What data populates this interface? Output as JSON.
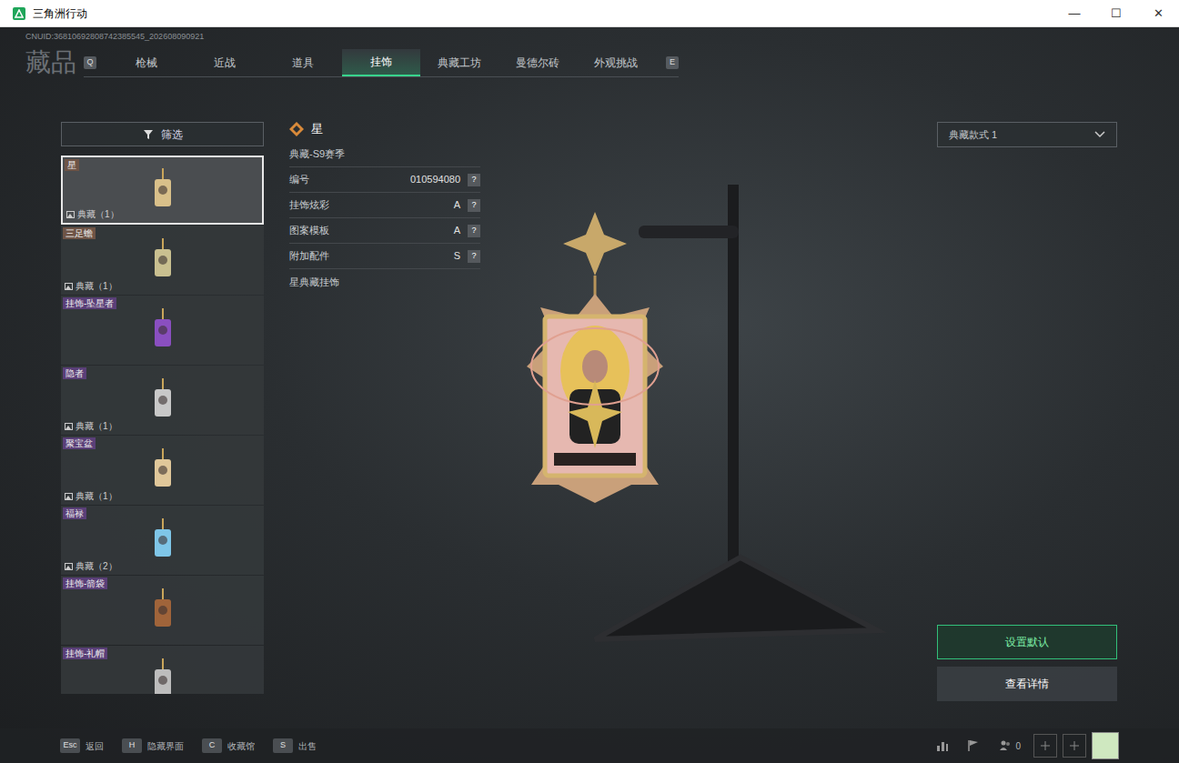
{
  "window": {
    "title": "三角洲行动",
    "controls": [
      "—",
      "☐",
      "✕"
    ]
  },
  "uid": "CNUID:36810692808742385545_202608090921",
  "page_title": "藏品",
  "tabs": {
    "prev_key": "Q",
    "next_key": "E",
    "items": [
      {
        "label": "枪械",
        "selected": false
      },
      {
        "label": "近战",
        "selected": false
      },
      {
        "label": "道具",
        "selected": false
      },
      {
        "label": "挂饰",
        "selected": true
      },
      {
        "label": "典藏工坊",
        "selected": false
      },
      {
        "label": "曼德尔砖",
        "selected": false
      },
      {
        "label": "外观挑战",
        "selected": false
      }
    ]
  },
  "filter": {
    "label": "筛选"
  },
  "items": [
    {
      "name": "星",
      "count": "典藏（1）",
      "selected": true,
      "color": "#6e5446"
    },
    {
      "name": "三足蟾",
      "count": "典藏（1）",
      "selected": false,
      "color": "#6e5446"
    },
    {
      "name": "挂饰-坠星者",
      "selected": false,
      "color": "#5a3f78"
    },
    {
      "name": "隐者",
      "count": "典藏（1）",
      "selected": false,
      "color": "#5a3f78"
    },
    {
      "name": "聚宝盆",
      "count": "典藏（1）",
      "selected": false,
      "color": "#5a3f78"
    },
    {
      "name": "福禄",
      "count": "典藏（2）",
      "selected": false,
      "color": "#5a3f78"
    },
    {
      "name": "挂饰-箭袋",
      "selected": false,
      "color": "#5a3f78"
    },
    {
      "name": "挂饰-礼帽",
      "selected": false,
      "color": "#5a3f78"
    }
  ],
  "detail": {
    "title": "星",
    "subtitle": "典藏-S9赛季",
    "attributes": [
      {
        "label": "编号",
        "value": "010594080",
        "help": "?"
      },
      {
        "label": "挂饰炫彩",
        "value": "A",
        "help": "?"
      },
      {
        "label": "图案模板",
        "value": "A",
        "help": "?"
      },
      {
        "label": "附加配件",
        "value": "S",
        "help": "?"
      }
    ],
    "description": "星典藏挂饰"
  },
  "style_select": {
    "value": "典藏款式 1"
  },
  "actions": [
    {
      "label": "设置默认",
      "primary": true
    },
    {
      "label": "查看详情",
      "primary": false
    }
  ],
  "bottom_bar": {
    "hints": [
      {
        "key": "Esc",
        "label": "返回"
      },
      {
        "key": "H",
        "label": "隐藏界面"
      },
      {
        "key": "C",
        "label": "收藏馆"
      },
      {
        "key": "S",
        "label": "出售"
      }
    ],
    "friends_count": "0"
  }
}
